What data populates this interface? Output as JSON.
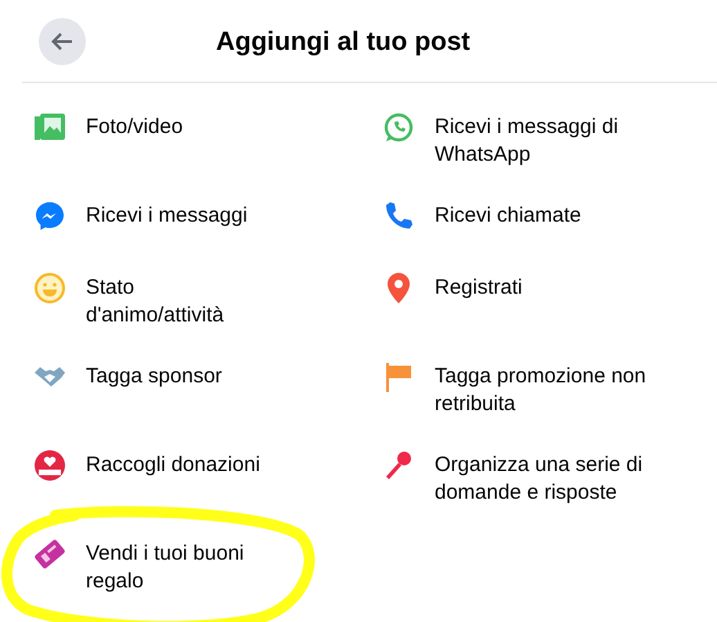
{
  "header": {
    "title": "Aggiungi al tuo post"
  },
  "items": [
    {
      "label": "Foto/video",
      "highlighted": false
    },
    {
      "label": "Ricevi i messaggi di WhatsApp",
      "highlighted": false
    },
    {
      "label": "Ricevi i messaggi",
      "highlighted": false
    },
    {
      "label": "Ricevi chiamate",
      "highlighted": false
    },
    {
      "label": "Stato d'animo/attività",
      "highlighted": false
    },
    {
      "label": "Registrati",
      "highlighted": false
    },
    {
      "label": "Tagga sponsor",
      "highlighted": false
    },
    {
      "label": "Tagga promozione non retribuita",
      "highlighted": false
    },
    {
      "label": "Raccogli donazioni",
      "highlighted": false
    },
    {
      "label": "Organizza una serie di domande e risposte",
      "highlighted": false
    },
    {
      "label": "Vendi i tuoi buoni regalo",
      "highlighted": true
    }
  ]
}
